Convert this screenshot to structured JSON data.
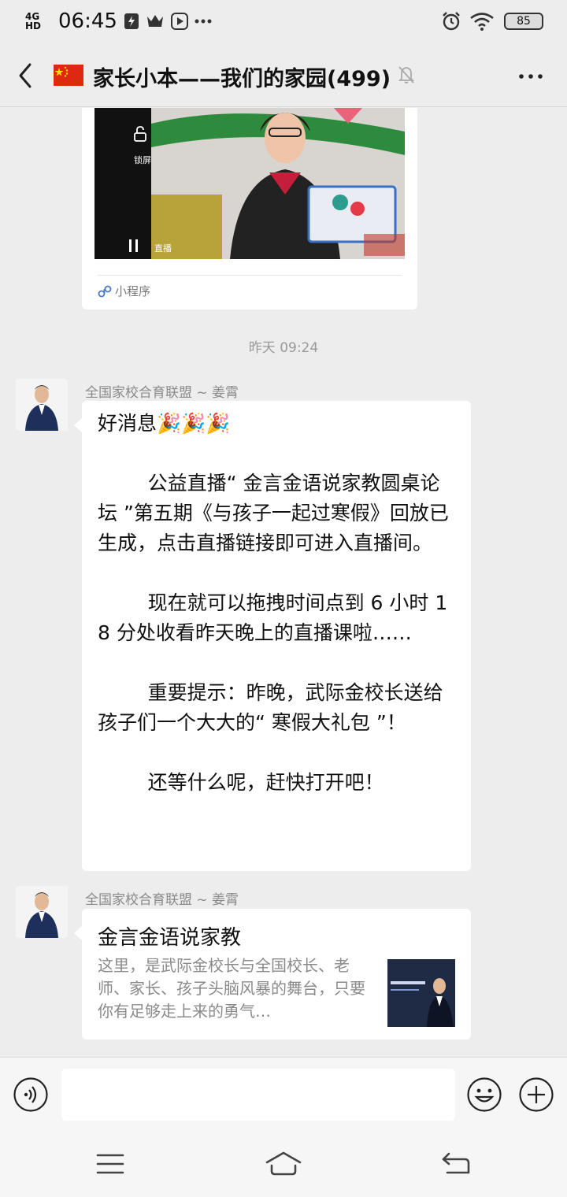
{
  "status_bar": {
    "network": "4G HD",
    "time": "06:45",
    "battery": "85"
  },
  "header": {
    "title": "家长小本——我们的家园(499)"
  },
  "mini_program": {
    "lock_label": "锁屏",
    "live_label": "直播",
    "footer_label": "小程序"
  },
  "timestamp": "昨天 09:24",
  "messages": [
    {
      "sender": "全国家校合育联盟 ~ 姜霄",
      "text": "好消息🎉🎉🎉\n\n        公益直播“ 金言金语说家教圆桌论坛 ”第五期《与孩子一起过寒假》回放已生成，点击直播链接即可进入直播间。\n\n        现在就可以拖拽时间点到 6 小时 18 分处收看昨天晚上的直播课啦……\n\n        重要提示：昨晚，武际金校长送给孩子们一个大大的“ 寒假大礼包 ”！\n\n        还等什么呢，赶快打开吧！"
    },
    {
      "sender": "全国家校合育联盟 ~ 姜霄",
      "link_title": "金言金语说家教",
      "link_desc": "这里，是武际金校长与全国校长、老师、家长、孩子头脑风暴的舞台，只要你有足够走上来的勇气…"
    }
  ],
  "input": {
    "value": ""
  },
  "colors": {
    "background": "#ededed",
    "bubble": "#ffffff",
    "meta_text": "#8a8a8a"
  },
  "icons": [
    "back-icon",
    "china-flag-icon",
    "mute-bell-icon",
    "more-icon",
    "voice-icon",
    "emoji-icon",
    "plus-icon",
    "menu-icon",
    "home-icon",
    "return-icon"
  ]
}
